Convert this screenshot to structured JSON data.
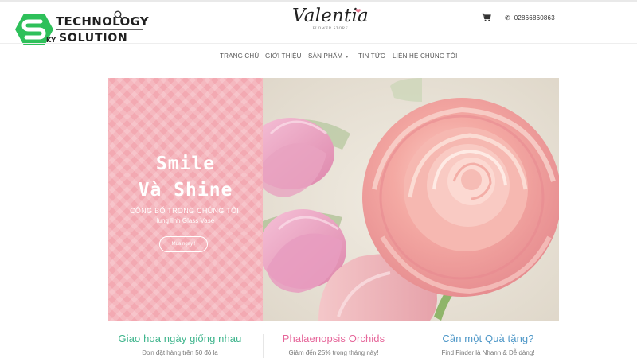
{
  "watermark": {
    "line1": "TECHNOLOGY",
    "line2": "SOLUTION",
    "badge_small": "KY",
    "color": "#2ec05a"
  },
  "header": {
    "brand_name": "Valentia",
    "brand_sub": "FLOWER STORE",
    "phone": "02866860863"
  },
  "nav": {
    "items": [
      {
        "label": "TRANG CHỦ"
      },
      {
        "label": "GIỚI THIỆU"
      },
      {
        "label": "SẢN PHẨM"
      },
      {
        "label": "TIN TỨC"
      },
      {
        "label": "LIÊN HỆ CHÚNG TÔI"
      }
    ]
  },
  "hero": {
    "title_line1": "Smile",
    "title_line2": "Và Shine",
    "subtitle": "CÔNG BỐ TRONG CHÚNG TÔI!",
    "subtitle2": "lung linh Glass Vase",
    "button": "Mua ngay !",
    "panel_color": "#f3a9b2"
  },
  "features": [
    {
      "title": "Giao hoa ngày giống nhau",
      "text": "Đơn đặt hàng trên 50 đô la",
      "color": "#3fb58d"
    },
    {
      "title": "Phalaenopsis Orchids",
      "text": "Giảm đến 25% trong tháng này!",
      "color": "#e6669a"
    },
    {
      "title": "Cần một Quà tặng?",
      "text": "Find Finder là Nhanh & Dễ dàng!",
      "color": "#4f98c8"
    }
  ]
}
